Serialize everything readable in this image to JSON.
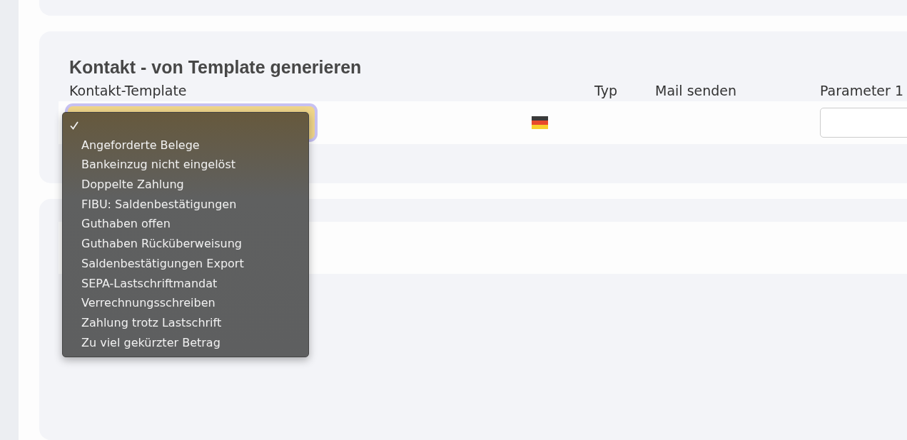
{
  "section": {
    "title": "Kontakt - von Template generieren",
    "columns": [
      {
        "label": "Kontakt-Template"
      },
      {},
      {
        "label": "Typ"
      },
      {
        "label": "Mail senden"
      },
      {
        "label": "Parameter 1"
      }
    ]
  },
  "row": {
    "template_select": {
      "focused": true,
      "expanded": true
    }
  },
  "menu": [
    {
      "selected": true
    },
    {
      "label": "Angeforderte Belege",
      "selected": false
    },
    {
      "label": "Bankeinzug nicht eingelöst",
      "selected": false
    },
    {
      "label": "Doppelte Zahlung",
      "selected": false
    },
    {
      "label": "FIBU: Saldenbestätigungen",
      "selected": false
    },
    {
      "label": "Guthaben offen",
      "selected": false
    },
    {
      "label": "Guthaben Rücküberweisung",
      "selected": false
    },
    {
      "label": "Saldenbestätigungen Export",
      "selected": false
    },
    {
      "label": "SEPA-Lastschriftmandat",
      "selected": false
    },
    {
      "label": "Verrechnungsschreiben",
      "selected": false
    },
    {
      "label": "Zahlung trotz Lastschrift",
      "selected": false
    },
    {
      "label": "Zu viel gekürzter Betrag",
      "selected": false
    }
  ]
}
